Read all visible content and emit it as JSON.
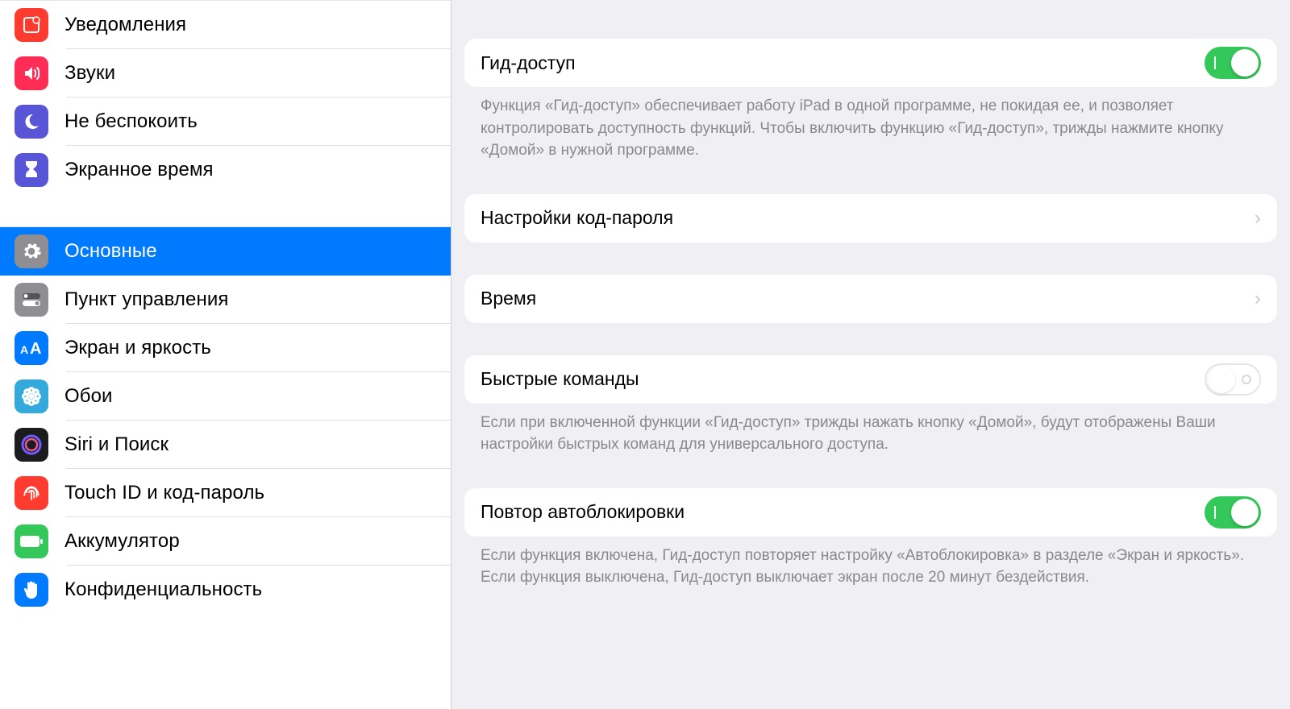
{
  "sidebar": {
    "group1": [
      {
        "label": "Уведомления"
      },
      {
        "label": "Звуки"
      },
      {
        "label": "Не беспокоить"
      },
      {
        "label": "Экранное время"
      }
    ],
    "group2": [
      {
        "label": "Основные"
      },
      {
        "label": "Пункт управления"
      },
      {
        "label": "Экран и яркость"
      },
      {
        "label": "Обои"
      },
      {
        "label": "Siri и Поиск"
      },
      {
        "label": "Touch ID и код-пароль"
      },
      {
        "label": "Аккумулятор"
      },
      {
        "label": "Конфиденциальность"
      }
    ]
  },
  "main": {
    "guided_access": {
      "label": "Гид-доступ",
      "on": true,
      "footer": "Функция «Гид-доступ» обеспечивает работу iPad в одной программе, не покидая ее, и позволяет контролировать доступность функций. Чтобы включить функцию «Гид-доступ», трижды нажмите кнопку «Домой» в нужной программе."
    },
    "passcode": {
      "label": "Настройки код-пароля"
    },
    "time": {
      "label": "Время"
    },
    "shortcuts": {
      "label": "Быстрые команды",
      "on": false,
      "footer": "Если при включенной функции «Гид-доступ» трижды нажать кнопку «Домой», будут отображены Ваши настройки быстрых команд для универсального доступа."
    },
    "autolock": {
      "label": "Повтор автоблокировки",
      "on": true,
      "footer": "Если функция включена, Гид-доступ повторяет настройку «Автоблокировка» в разделе «Экран и яркость». Если функция выключена, Гид-доступ выключает экран после 20 минут бездействия."
    }
  }
}
